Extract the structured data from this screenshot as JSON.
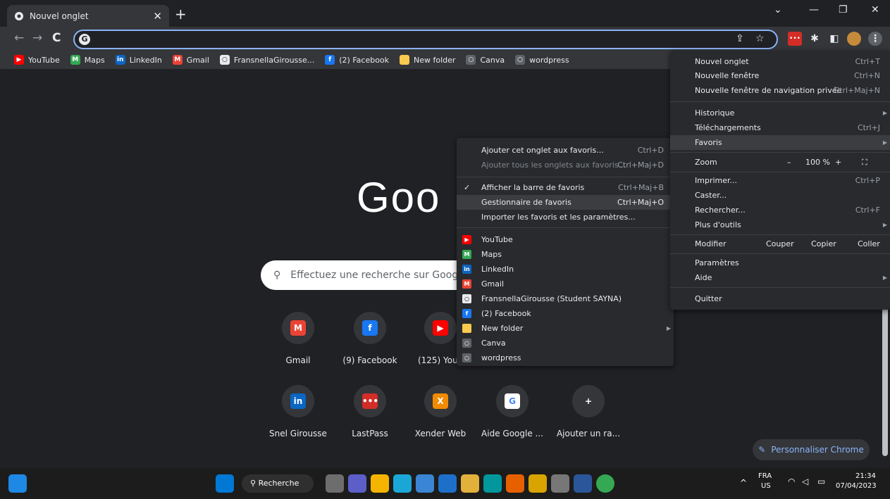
{
  "tab": {
    "title": "Nouvel onglet",
    "close": "✕",
    "new_tab": "+"
  },
  "window_controls": {
    "collapse": "⌄",
    "minimize": "—",
    "restore": "❐",
    "close": "✕"
  },
  "nav": {
    "back": "←",
    "forward": "→",
    "reload": "C"
  },
  "omnibox": {
    "value": "",
    "share_icon": "⇪",
    "star_icon": "☆"
  },
  "bookmarks": [
    {
      "label": "YouTube",
      "icon": "youtube-icon",
      "color": "#ff0000",
      "glyph": "▶"
    },
    {
      "label": "Maps",
      "icon": "maps-icon",
      "color": "#34a853",
      "glyph": "M"
    },
    {
      "label": "LinkedIn",
      "icon": "linkedin-icon",
      "color": "#0a66c2",
      "glyph": "in"
    },
    {
      "label": "Gmail",
      "icon": "gmail-icon",
      "color": "#ea4335",
      "glyph": "M"
    },
    {
      "label": "FransnellaGirousse...",
      "icon": "github-icon",
      "color": "#e8eaed",
      "glyph": "○"
    },
    {
      "label": "(2) Facebook",
      "icon": "facebook-icon",
      "color": "#1877f2",
      "glyph": "f"
    },
    {
      "label": "New folder",
      "icon": "folder-icon",
      "color": "#f9ca4f",
      "glyph": ""
    },
    {
      "label": "Canva",
      "icon": "globe-icon",
      "color": "#5f6368",
      "glyph": "○"
    },
    {
      "label": "wordpress",
      "icon": "globe-icon",
      "color": "#5f6368",
      "glyph": "○"
    }
  ],
  "google_logo": "Goo",
  "search": {
    "placeholder": "Effectuez une recherche sur Google",
    "icon": "🔍"
  },
  "shortcuts_row1": [
    {
      "label": "Gmail",
      "icon": "gmail-icon",
      "color": "#ea4335",
      "glyph": "M"
    },
    {
      "label": "(9) Facebook",
      "icon": "facebook-icon",
      "color": "#1877f2",
      "glyph": "f"
    },
    {
      "label": "(125) YouT",
      "icon": "youtube-icon",
      "color": "#ff0000",
      "glyph": "▶"
    }
  ],
  "shortcuts_row2": [
    {
      "label": "Snel Girousse",
      "icon": "linkedin-icon",
      "color": "#0a66c2",
      "glyph": "in"
    },
    {
      "label": "LastPass",
      "icon": "lastpass-icon",
      "color": "#d32d27",
      "glyph": "•••"
    },
    {
      "label": "Xender Web",
      "icon": "xender-icon",
      "color": "#f28b00",
      "glyph": "X"
    },
    {
      "label": "Aide Google ...",
      "icon": "google-icon",
      "color": "#ffffff",
      "glyph": "G"
    },
    {
      "label": "Ajouter un ra...",
      "icon": "plus-icon",
      "color": "#35363a",
      "glyph": "+"
    }
  ],
  "customize": {
    "label": "Personnaliser Chrome",
    "icon": "✎"
  },
  "main_menu": {
    "new_tab": {
      "label": "Nouvel onglet",
      "shortcut": "Ctrl+T"
    },
    "new_window": {
      "label": "Nouvelle fenêtre",
      "shortcut": "Ctrl+N"
    },
    "incognito": {
      "label": "Nouvelle fenêtre de navigation privée",
      "shortcut": "Ctrl+Maj+N"
    },
    "history": {
      "label": "Historique"
    },
    "downloads": {
      "label": "Téléchargements",
      "shortcut": "Ctrl+J"
    },
    "favorites": {
      "label": "Favoris"
    },
    "zoom": {
      "label": "Zoom",
      "minus": "–",
      "value": "100 %",
      "plus": "+",
      "fullscreen": "⛶"
    },
    "print": {
      "label": "Imprimer...",
      "shortcut": "Ctrl+P"
    },
    "cast": {
      "label": "Caster..."
    },
    "find": {
      "label": "Rechercher...",
      "shortcut": "Ctrl+F"
    },
    "more_tools": {
      "label": "Plus d'outils"
    },
    "edit": {
      "label": "Modifier",
      "cut": "Couper",
      "copy": "Copier",
      "paste": "Coller"
    },
    "settings": {
      "label": "Paramètres"
    },
    "help": {
      "label": "Aide"
    },
    "quit": {
      "label": "Quitter"
    }
  },
  "fav_menu": {
    "add_tab": {
      "label": "Ajouter cet onglet aux favoris...",
      "shortcut": "Ctrl+D"
    },
    "add_all": {
      "label": "Ajouter tous les onglets aux favoris...",
      "shortcut": "Ctrl+Maj+D"
    },
    "show_bar": {
      "label": "Afficher la barre de favoris",
      "shortcut": "Ctrl+Maj+B"
    },
    "manager": {
      "label": "Gestionnaire de favoris",
      "shortcut": "Ctrl+Maj+O"
    },
    "import": {
      "label": "Importer les favoris et les paramètres..."
    },
    "items": [
      {
        "label": "YouTube",
        "icon": "youtube-icon",
        "color": "#ff0000",
        "glyph": "▶"
      },
      {
        "label": "Maps",
        "icon": "maps-icon",
        "color": "#34a853",
        "glyph": "M"
      },
      {
        "label": "LinkedIn",
        "icon": "linkedin-icon",
        "color": "#0a66c2",
        "glyph": "in"
      },
      {
        "label": "Gmail",
        "icon": "gmail-icon",
        "color": "#ea4335",
        "glyph": "M"
      },
      {
        "label": "FransnellaGirousse (Student SAYNA)",
        "icon": "github-icon",
        "color": "#e8eaed",
        "glyph": "○"
      },
      {
        "label": "(2) Facebook",
        "icon": "facebook-icon",
        "color": "#1877f2",
        "glyph": "f"
      },
      {
        "label": "New folder",
        "icon": "folder-icon",
        "color": "#f9ca4f",
        "glyph": ""
      },
      {
        "label": "Canva",
        "icon": "globe-icon",
        "color": "#5f6368",
        "glyph": "○"
      },
      {
        "label": "wordpress",
        "icon": "globe-icon",
        "color": "#5f6368",
        "glyph": "○"
      }
    ]
  },
  "taskbar": {
    "search_label": "Recherche",
    "lang_top": "FRA",
    "lang_bottom": "US",
    "time": "21:34",
    "date": "07/04/2023"
  }
}
